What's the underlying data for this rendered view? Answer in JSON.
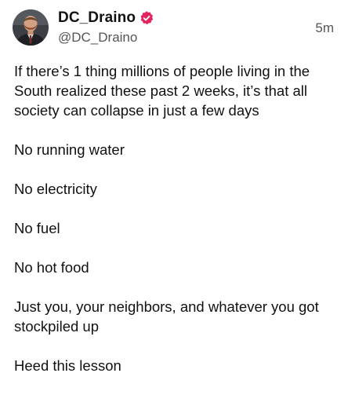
{
  "post": {
    "author": {
      "display_name": "DC_Draino",
      "handle": "@DC_Draino",
      "verified": true,
      "verified_badge_color": "#e0245e",
      "avatar_icon": "profile-photo"
    },
    "timestamp": "5m",
    "paragraphs": [
      "If there’s 1 thing millions of people living in the South realized these past 2 weeks, it’s that all society can collapse in just a few days",
      "No running water",
      "No electricity",
      "No fuel",
      "No hot food",
      "Just you, your neighbors, and whatever you got stockpiled up",
      "Heed this lesson"
    ]
  }
}
